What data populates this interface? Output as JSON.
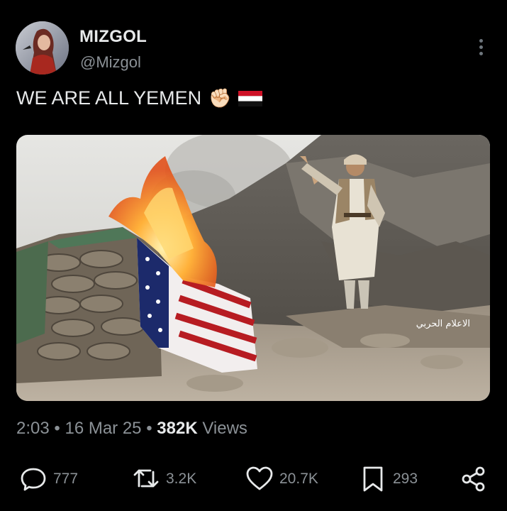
{
  "post": {
    "author_name": "MIZGOL",
    "author_handle": "@Mizgol",
    "text": "WE ARE ALL YEMEN",
    "emoji": "✊🏻",
    "flag": "yemen-flag",
    "image_caption_ar": "الاعلام الحربي",
    "time": "2:03",
    "date": "16 Mar 25",
    "views_count": "382K",
    "views_label": "Views",
    "separator": "•"
  },
  "actions": {
    "replies": "777",
    "reposts": "3.2K",
    "likes": "20.7K",
    "bookmarks": "293"
  },
  "colors": {
    "background": "#000000",
    "text": "#e7e9ea",
    "secondary": "#8b9196"
  }
}
